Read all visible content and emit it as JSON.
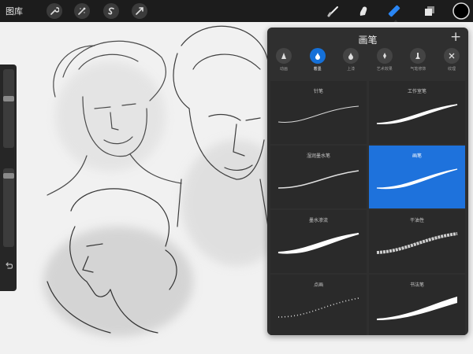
{
  "topbar": {
    "gallery_label": "图库",
    "tools": [
      {
        "icon": "wrench-icon"
      },
      {
        "icon": "adjustments-icon"
      },
      {
        "icon": "selection-icon"
      },
      {
        "icon": "transform-arrow-icon"
      },
      {
        "icon": "paint-brush-icon"
      },
      {
        "icon": "smudge-icon"
      },
      {
        "icon": "eraser-icon",
        "active": true
      },
      {
        "icon": "layers-icon"
      },
      {
        "icon": "color-swatch-icon"
      }
    ]
  },
  "sidebar": {
    "brush_size_icon": "slider-thumb",
    "opacity_icon": "slider-thumb",
    "undo_icon": "undo-icon"
  },
  "panel": {
    "title": "画笔",
    "add_icon": "plus-icon",
    "sets": [
      {
        "label": "动画",
        "icon": "cone-icon"
      },
      {
        "label": "着墨",
        "icon": "ink-drop-icon",
        "selected": true
      },
      {
        "label": "上漆",
        "icon": "paint-drop-icon"
      },
      {
        "label": "艺术效果",
        "icon": "artistic-icon"
      },
      {
        "label": "气笔修饰",
        "icon": "airbrush-icon"
      },
      {
        "label": "纹理",
        "icon": "texture-icon"
      }
    ],
    "brushes": [
      {
        "name": "针笔"
      },
      {
        "name": "工作室笔"
      },
      {
        "name": "湿润墨水笔"
      },
      {
        "name": "画笔",
        "selected": true
      },
      {
        "name": "墨水渗流"
      },
      {
        "name": "干油性"
      },
      {
        "name": "点画"
      },
      {
        "name": "书法笔"
      }
    ]
  },
  "colors": {
    "accent": "#1e72dc",
    "toolbar": "#1c1c1c",
    "panel": "#2f2f2f"
  }
}
